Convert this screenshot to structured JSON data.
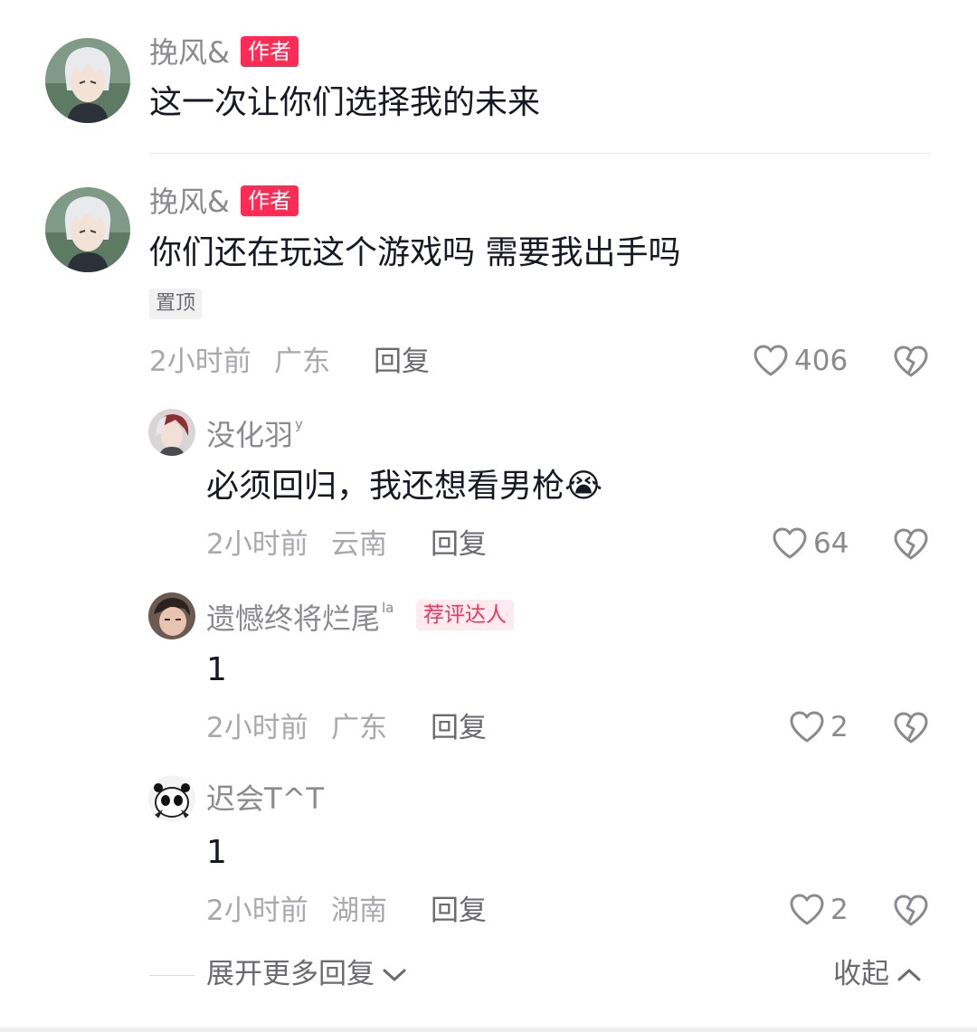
{
  "comments": [
    {
      "user": "挽风&",
      "badge": "作者",
      "text": "这一次让你们选择我的未来",
      "avatar_icon": "avatar-anime-white-hair"
    },
    {
      "user": "挽风&",
      "badge": "作者",
      "text": "你们还在玩这个游戏吗 需要我出手吗",
      "pinned": "置顶",
      "time": "2小时前",
      "location": "广东",
      "reply_label": "回复",
      "likes": "406",
      "avatar_icon": "avatar-anime-white-hair"
    }
  ],
  "replies": [
    {
      "user": "没化羽",
      "user_suffix": "y",
      "text": "必须回归，我还想看男枪",
      "emoji": "😭",
      "time": "2小时前",
      "location": "云南",
      "reply_label": "回复",
      "likes": "64"
    },
    {
      "user": "遗憾终将烂尾",
      "user_suffix": "la",
      "badge": "荐评达人",
      "text": "1",
      "time": "2小时前",
      "location": "广东",
      "reply_label": "回复",
      "likes": "2"
    },
    {
      "user": "迟会T^T",
      "text": "1",
      "time": "2小时前",
      "location": "湖南",
      "reply_label": "回复",
      "likes": "2"
    }
  ],
  "footer": {
    "expand_label": "展开更多回复",
    "collapse_label": "收起"
  },
  "colors": {
    "accent": "#fe2c55",
    "text_primary": "#161823",
    "text_secondary": "#8a8a8f"
  }
}
